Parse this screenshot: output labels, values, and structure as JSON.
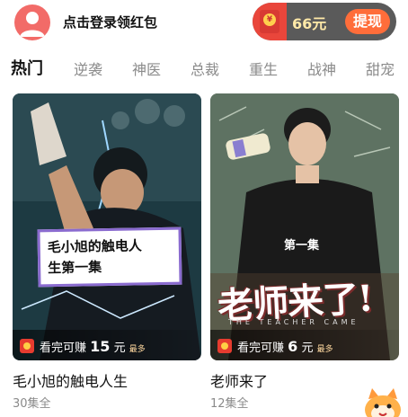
{
  "header": {
    "login_text": "点击登录领红包",
    "wallet": {
      "amount": "66元",
      "withdraw_label": "提现",
      "coin_symbol": "¥"
    }
  },
  "tabs": [
    {
      "label": "热门",
      "active": true
    },
    {
      "label": "逆袭",
      "active": false
    },
    {
      "label": "神医",
      "active": false
    },
    {
      "label": "总裁",
      "active": false
    },
    {
      "label": "重生",
      "active": false
    },
    {
      "label": "战神",
      "active": false
    },
    {
      "label": "甜宠",
      "active": false
    }
  ],
  "dramas": [
    {
      "title": "毛小旭的触电人生",
      "episodes": "30集全",
      "poster_caption_line1": "毛小旭的触电人",
      "poster_caption_line2": "生第一集",
      "reward_prefix": "看完可赚",
      "reward_amount": "15",
      "reward_unit": "元",
      "reward_max": "最多"
    },
    {
      "title": "老师来了",
      "episodes": "12集全",
      "poster_episode": "第一集",
      "poster_title": "老师来了!",
      "poster_subtitle": "THE TEACHER CAME",
      "reward_prefix": "看完可赚",
      "reward_amount": "6",
      "reward_unit": "元",
      "reward_max": "最多"
    }
  ],
  "colors": {
    "accent": "#ff6d3a",
    "wallet_bg": "#5a5a5a",
    "red": "#e9463b"
  }
}
